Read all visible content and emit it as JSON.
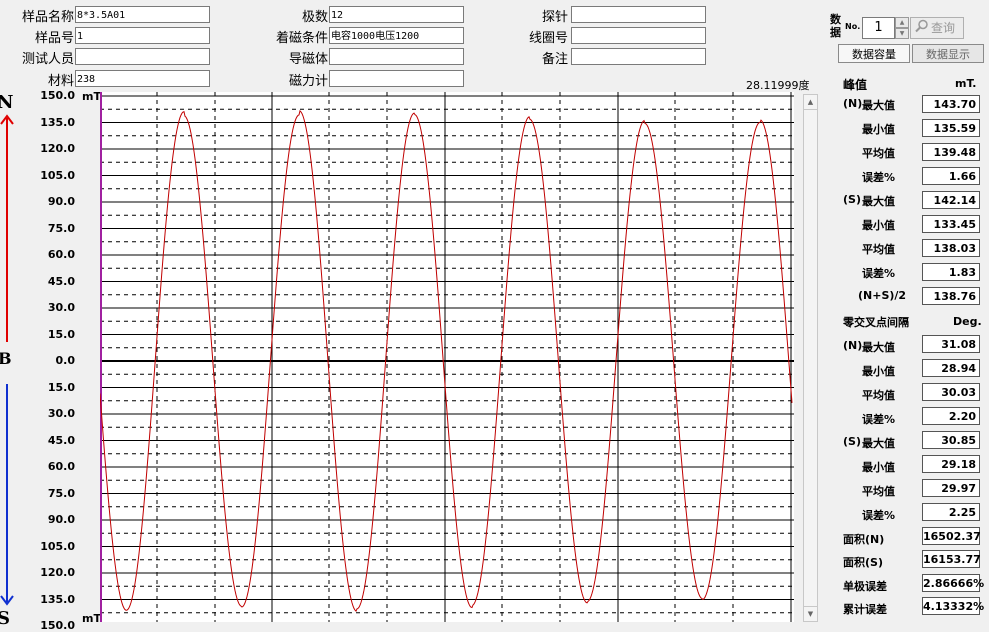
{
  "form": {
    "sample_name": {
      "label": "样品名称",
      "value": "8*3.5A01"
    },
    "sample_no": {
      "label": "样品号",
      "value": "1"
    },
    "tester": {
      "label": "测试人员",
      "value": ""
    },
    "material": {
      "label": "材料",
      "value": "238"
    },
    "poles": {
      "label": "极数",
      "value": "12"
    },
    "magnetizing": {
      "label": "着磁条件",
      "value": "电容1000电压1200"
    },
    "yoke": {
      "label": "导磁体",
      "value": ""
    },
    "magnetometer": {
      "label": "磁力计",
      "value": ""
    },
    "probe": {
      "label": "探针",
      "value": ""
    },
    "coil_no": {
      "label": "线圈号",
      "value": ""
    },
    "remark": {
      "label": "备注",
      "value": ""
    }
  },
  "record": {
    "label_top": "数",
    "label_bottom": "据",
    "no_label": "No.",
    "no_value": "1",
    "query_label": "查询"
  },
  "tabs": {
    "capacity": "数据容量",
    "display": "数据显示"
  },
  "angle_readout": "28.11999度",
  "chart_axis": {
    "unit": "mT",
    "top_label": "N",
    "mid_label": "B",
    "bottom_label": "S",
    "tick_labels": [
      "150.0",
      "135.0",
      "120.0",
      "105.0",
      "90.0",
      "75.0",
      "60.0",
      "45.0",
      "30.0",
      "15.0",
      "0.0",
      "15.0",
      "30.0",
      "45.0",
      "60.0",
      "75.0",
      "90.0",
      "105.0",
      "120.0",
      "135.0",
      "150.0"
    ]
  },
  "chart_data": {
    "type": "line",
    "ylim": [
      -150,
      150
    ],
    "ylabel": "mT",
    "n_peaks": [
      141.1,
      142.1,
      139.4,
      136.9,
      135.6,
      136.7
    ],
    "s_peaks": [
      -136.5,
      -141.3,
      -139.7,
      -136.8,
      -133.4,
      -136.3
    ],
    "grid": true,
    "line_color": "#c00000"
  },
  "results": {
    "peak_header": "峰值",
    "peak_unit": "mT.",
    "n": {
      "prefix": "(N)",
      "max_label": "最大值",
      "max": "143.70",
      "min_label": "最小值",
      "min": "135.59",
      "avg_label": "平均值",
      "avg": "139.48",
      "err_label": "误差%",
      "err": "1.66"
    },
    "s": {
      "prefix": "(S)",
      "max_label": "最大值",
      "max": "142.14",
      "min_label": "最小值",
      "min": "133.45",
      "avg_label": "平均值",
      "avg": "138.03",
      "err_label": "误差%",
      "err": "1.83"
    },
    "ns_half_label": "(N+S)/2",
    "ns_half": "138.76",
    "zero_header": "零交叉点间隔",
    "zero_unit": "Deg.",
    "zn": {
      "prefix": "(N)",
      "max_label": "最大值",
      "max": "31.08",
      "min_label": "最小值",
      "min": "28.94",
      "avg_label": "平均值",
      "avg": "30.03",
      "err_label": "误差%",
      "err": "2.20"
    },
    "zs": {
      "prefix": "(S)",
      "max_label": "最大值",
      "max": "30.85",
      "min_label": "最小值",
      "min": "29.18",
      "avg_label": "平均值",
      "avg": "29.97",
      "err_label": "误差%",
      "err": "2.25"
    },
    "area_n_label": "面积(N)",
    "area_n": "16502.37",
    "area_s_label": "面积(S)",
    "area_s": "16153.77",
    "single_err_label": "单极误差",
    "single_err": "2.86666%",
    "total_err_label": "累计误差",
    "total_err": "4.13332%"
  }
}
